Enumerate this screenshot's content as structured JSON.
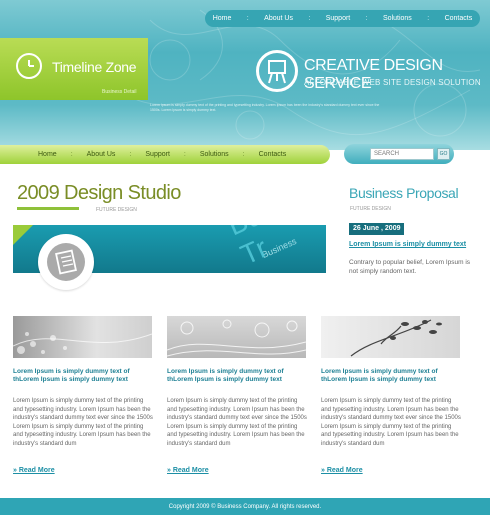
{
  "top_nav": {
    "items": [
      "Home",
      "About Us",
      "Support",
      "Solutions",
      "Contacts"
    ],
    "separator": ":"
  },
  "brand": {
    "title": "Timeline Zone",
    "subtitle": "Business Detail"
  },
  "hero": {
    "title": "CREATIVE DESIGN SERVICE",
    "subtitle": "AFFORDABLE WEB SITE DESIGN SOLUTION",
    "lorem": "Lorem Ipsum is simply dummy text of the printing and typesetting industry. Lorem Ipsum has been the industry's standard dummy text ever since the 1500s. Lorem Ipsum is simply dummy text."
  },
  "menu": {
    "items": [
      "Home",
      "About Us",
      "Support",
      "Solutions",
      "Contacts"
    ],
    "separator": ":"
  },
  "search": {
    "placeholder": "SEARCH",
    "go_label": "GO"
  },
  "studio": {
    "title": "2009 Design Studio",
    "subtitle": "FUTURE DESIGN",
    "banner_text": "Business Tr",
    "banner_small": "Business"
  },
  "proposal": {
    "title": "Business Proposal",
    "subtitle": "FUTURE DESIGN",
    "date": "26 June , 2009",
    "link": "Lorem Ipsum is simply dummy text",
    "text": "Contrary to popular belief, Lorem Ipsum is not simply random text."
  },
  "columns": [
    {
      "heading": "Lorem Ipsum is simply dummy text of thLorem Ipsum is simply dummy text",
      "body": "Lorem Ipsum is simply dummy text of the printing and typesetting industry. Lorem Ipsum has been the industry's standard dummy text ever since the 1500s Lorem Ipsum is simply dummy text of the printing and typesetting industry. Lorem Ipsum has been the industry's standard dum",
      "more": "» Read More"
    },
    {
      "heading": "Lorem Ipsum is simply dummy text of thLorem Ipsum is simply dummy text",
      "body": "Lorem Ipsum is simply dummy text of the printing and typesetting industry. Lorem Ipsum has been the industry's standard dummy text ever since the 1500s Lorem Ipsum is simply dummy text of the printing and typesetting industry. Lorem Ipsum has been the industry's standard dum",
      "more": "» Read More"
    },
    {
      "heading": "Lorem Ipsum is simply dummy text of thLorem Ipsum is simply dummy text",
      "body": "Lorem Ipsum is simply dummy text of the printing and typesetting industry. Lorem Ipsum has been the industry's standard dummy text ever since the 1500s Lorem Ipsum is simply dummy text of the printing and typesetting industry. Lorem Ipsum has been the industry's standard dum",
      "more": "» Read More"
    }
  ],
  "footer": {
    "text": "Copyright 2009 © Business Company.  All rights reserved."
  },
  "icons": {
    "brand": "clock-icon",
    "hero": "easel-icon",
    "banner": "document-icon"
  },
  "colors": {
    "teal": "#2fa5b5",
    "lime": "#9fd23a",
    "olive_text": "#7a8d26",
    "link": "#1c8fa5"
  }
}
